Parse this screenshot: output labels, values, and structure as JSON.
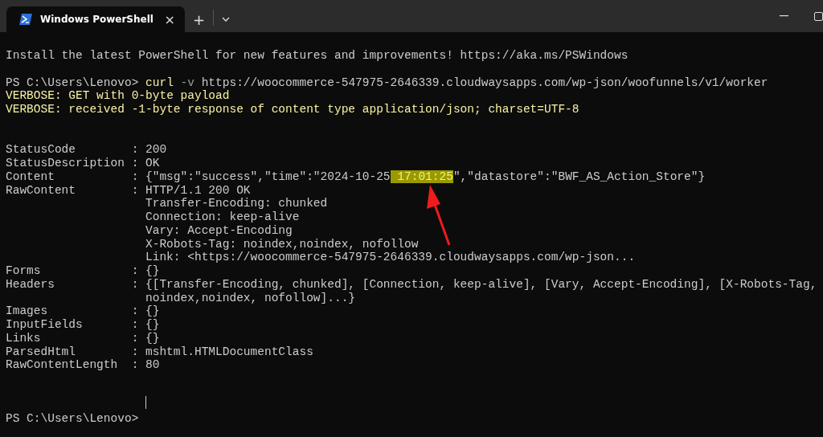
{
  "window": {
    "tab": {
      "title": "Windows PowerShell",
      "close": "×"
    },
    "new_tab": "+"
  },
  "lines": [
    {
      "kind": "text",
      "text": "Install the latest PowerShell for new features and improvements! https://aka.ms/PSWindows"
    },
    {
      "kind": "blank"
    },
    {
      "kind": "prompt",
      "prompt": "PS C:\\Users\\Lenovo>",
      "tokens": [
        {
          "kind": "command",
          "text": "curl"
        },
        {
          "kind": "parameter",
          "text": "-v"
        },
        {
          "kind": "argument",
          "text": "https://woocommerce-547975-2646339.cloudwaysapps.com/wp-json/woofunnels/v1/worker"
        }
      ]
    },
    {
      "kind": "verbose",
      "text": "VERBOSE: GET with 0-byte payload"
    },
    {
      "kind": "verbose",
      "text": "VERBOSE: received -1-byte response of content type application/json; charset=UTF-8"
    },
    {
      "kind": "blank"
    },
    {
      "kind": "blank"
    },
    {
      "kind": "property",
      "name": "StatusCode",
      "separator": ":",
      "lines": [
        "200"
      ]
    },
    {
      "kind": "property",
      "name": "StatusDescription",
      "separator": ":",
      "lines": [
        "OK"
      ]
    },
    {
      "kind": "property",
      "name": "Content",
      "separator": ":",
      "lines": [
        [
          {
            "text": "{\"msg\":\"success\",\"time\":\"2024-10-25",
            "highlighted": false
          },
          {
            "text": " 17:01:25",
            "highlighted": true
          },
          {
            "text": "\",\"datastore\":\"BWF_AS_Action_Store\"}",
            "highlighted": false
          }
        ]
      ]
    },
    {
      "kind": "property",
      "name": "RawContent",
      "separator": ":",
      "lines": [
        "HTTP/1.1 200 OK",
        "Transfer-Encoding: chunked",
        "Connection: keep-alive",
        "Vary: Accept-Encoding",
        "X-Robots-Tag: noindex,noindex, nofollow",
        "Link: <https://woocommerce-547975-2646339.cloudwaysapps.com/wp-json..."
      ]
    },
    {
      "kind": "property",
      "name": "Forms",
      "separator": ":",
      "lines": [
        "{}"
      ]
    },
    {
      "kind": "property",
      "name": "Headers",
      "separator": ":",
      "lines": [
        "{[Transfer-Encoding, chunked], [Connection, keep-alive], [Vary, Accept-Encoding], [X-Robots-Tag,",
        "noindex,noindex, nofollow]...}"
      ]
    },
    {
      "kind": "property",
      "name": "Images",
      "separator": ":",
      "lines": [
        "{}"
      ]
    },
    {
      "kind": "property",
      "name": "InputFields",
      "separator": ":",
      "lines": [
        "{}"
      ]
    },
    {
      "kind": "property",
      "name": "Links",
      "separator": ":",
      "lines": [
        "{}"
      ]
    },
    {
      "kind": "property",
      "name": "ParsedHtml",
      "separator": ":",
      "lines": [
        "mshtml.HTMLDocumentClass"
      ]
    },
    {
      "kind": "property",
      "name": "RawContentLength",
      "separator": ":",
      "lines": [
        "80"
      ]
    },
    {
      "kind": "blank"
    },
    {
      "kind": "blank"
    },
    {
      "kind": "cursor"
    },
    {
      "kind": "prompt",
      "prompt": "PS C:\\Users\\Lenovo>"
    }
  ]
}
